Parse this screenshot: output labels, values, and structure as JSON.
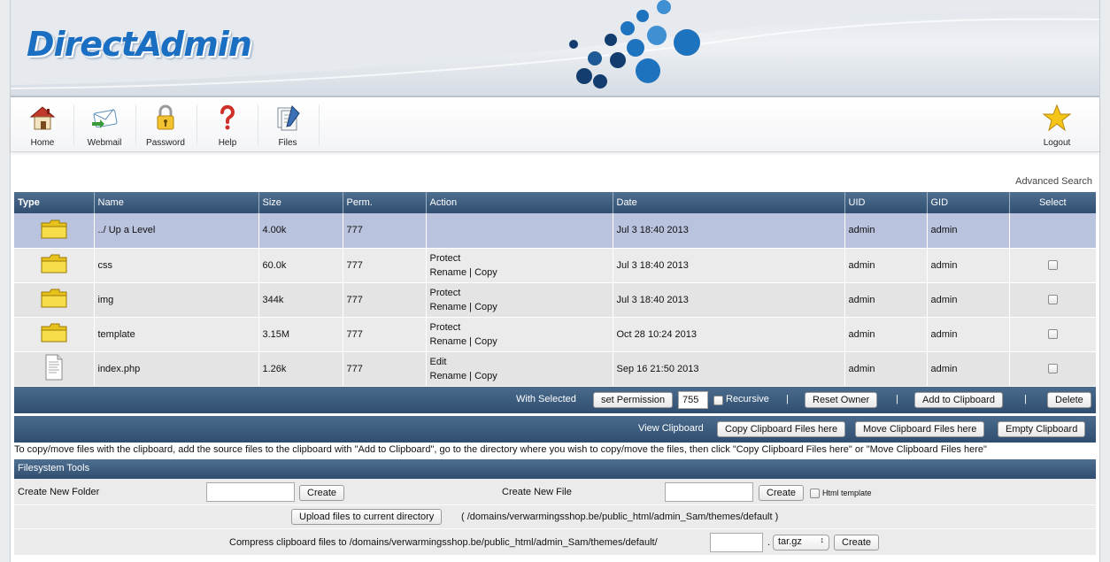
{
  "brand": {
    "logo_text": "DirectAdmin"
  },
  "nav": {
    "items": [
      {
        "label": "Home",
        "icon": "home-icon"
      },
      {
        "label": "Webmail",
        "icon": "mail-icon"
      },
      {
        "label": "Password",
        "icon": "lock-icon"
      },
      {
        "label": "Help",
        "icon": "question-icon"
      },
      {
        "label": "Files",
        "icon": "files-icon"
      }
    ],
    "logout": {
      "label": "Logout",
      "icon": "star-icon"
    }
  },
  "advanced_search": "Advanced Search",
  "table": {
    "headers": {
      "type": "Type",
      "name": "Name",
      "size": "Size",
      "perm": "Perm.",
      "action": "Action",
      "date": "Date",
      "uid": "UID",
      "gid": "GID",
      "select": "Select"
    },
    "rows": [
      {
        "icon": "folder-icon",
        "name": "../ Up a Level",
        "size": "4.00k",
        "perm": "777",
        "action1": "",
        "action2": "",
        "action3": "",
        "date": "Jul 3 18:40 2013",
        "uid": "admin",
        "gid": "admin"
      },
      {
        "icon": "folder-icon",
        "name": "css",
        "size": "60.0k",
        "perm": "777",
        "action1": "Protect",
        "action2": "Rename",
        "action3": "Copy",
        "date": "Jul 3 18:40 2013",
        "uid": "admin",
        "gid": "admin"
      },
      {
        "icon": "folder-icon",
        "name": "img",
        "size": "344k",
        "perm": "777",
        "action1": "Protect",
        "action2": "Rename",
        "action3": "Copy",
        "date": "Jul 3 18:40 2013",
        "uid": "admin",
        "gid": "admin"
      },
      {
        "icon": "folder-icon",
        "name": "template",
        "size": "3.15M",
        "perm": "777",
        "action1": "Protect",
        "action2": "Rename",
        "action3": "Copy",
        "date": "Oct 28 10:24 2013",
        "uid": "admin",
        "gid": "admin"
      },
      {
        "icon": "file-icon",
        "name": "index.php",
        "size": "1.26k",
        "perm": "777",
        "action1": "Edit",
        "action2": "Rename",
        "action3": "Copy",
        "date": "Sep 16 21:50 2013",
        "uid": "admin",
        "gid": "admin"
      }
    ],
    "separator": "|"
  },
  "with_selected": {
    "label": "With Selected",
    "set_permission": "set Permission",
    "permission_value": "755",
    "recursive": "Recursive",
    "reset_owner": "Reset Owner",
    "add_to_clipboard": "Add to Clipboard",
    "delete": "Delete",
    "pipe": "|"
  },
  "clipboard": {
    "label": "View Clipboard",
    "copy_here": "Copy Clipboard Files here",
    "move_here": "Move Clipboard Files here",
    "empty": "Empty Clipboard",
    "note": "To copy/move files with the clipboard, add the source files to the clipboard with \"Add to Clipboard\", go to the directory where you wish to copy/move the files, then click \"Copy Clipboard Files here\" or \"Move Clipboard Files here\""
  },
  "tools": {
    "title": "Filesystem Tools",
    "new_folder_label": "Create New Folder",
    "new_folder_value": "",
    "create": "Create",
    "new_file_label": "Create New File",
    "new_file_value": "",
    "html_template": "Html template",
    "upload_button": "Upload files to current directory",
    "upload_path": "( /domains/verwarmingsshop.be/public_html/admin_Sam/themes/default )",
    "compress_label": "Compress clipboard files to /domains/verwarmingsshop.be/public_html/admin_Sam/themes/default/",
    "compress_name": "",
    "dot": ".",
    "archive_format": "tar.gz",
    "compress_create": "Create"
  },
  "colors": {
    "header_bar": "#2f4e70",
    "highlight_row": "#b9c3de",
    "logo": "#1b6fc2"
  }
}
